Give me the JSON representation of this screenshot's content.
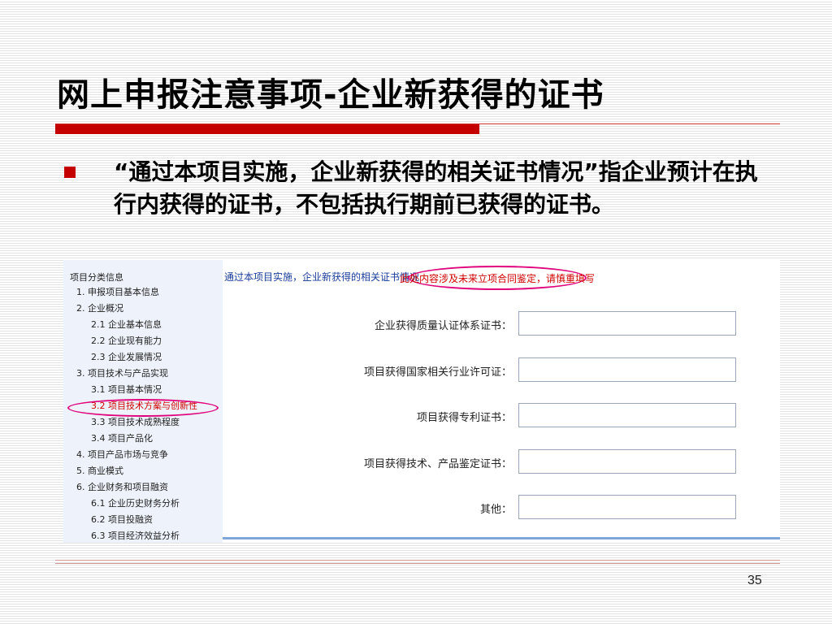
{
  "slide": {
    "title": "网上申报注意事项-企业新获得的证书",
    "bullet_text": "“通过本项目实施，企业新获得的相关证书情况”指企业预计在执行内获得的证书，不包括执行期前已获得的证书。",
    "page_number": "35"
  },
  "nav": {
    "heading": "项目分类信息",
    "items": [
      {
        "label": "1. 申报项目基本信息"
      },
      {
        "label": "2. 企业概况"
      },
      {
        "label": "2.1 企业基本信息"
      },
      {
        "label": "2.2 企业现有能力"
      },
      {
        "label": "2.3 企业发展情况"
      },
      {
        "label": "3. 项目技术与产品实现"
      },
      {
        "label": "3.1 项目基本情况"
      },
      {
        "label": "3.2 项目技术方案与创新性"
      },
      {
        "label": "3.3 项目技术成熟程度"
      },
      {
        "label": "3.4 项目产品化"
      },
      {
        "label": "4. 项目产品市场与竞争"
      },
      {
        "label": "5. 商业模式"
      },
      {
        "label": "6. 企业财务和项目融资"
      },
      {
        "label": "6.1 企业历史财务分析"
      },
      {
        "label": "6.2 项目投融资"
      },
      {
        "label": "6.3 项目经济效益分析"
      }
    ]
  },
  "form": {
    "header": "通过本项目实施，企业新获得的相关证书情况",
    "notice": "此处内容涉及未来立项合同鉴定，请慎重填写",
    "fields": [
      {
        "label": "企业获得质量认证体系证书：",
        "value": ""
      },
      {
        "label": "项目获得国家相关行业许可证：",
        "value": ""
      },
      {
        "label": "项目获得专利证书：",
        "value": ""
      },
      {
        "label": "项目获得技术、产品鉴定证书：",
        "value": ""
      },
      {
        "label": "其他：",
        "value": ""
      }
    ]
  },
  "colors": {
    "accent_red": "#c40000",
    "highlight_magenta": "#e0007a",
    "nav_background": "#eef3fb",
    "header_blue": "#1a3d99"
  }
}
